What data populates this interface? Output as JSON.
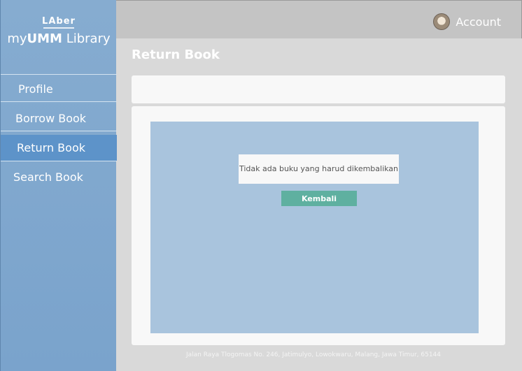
{
  "logo": {
    "mark": "LAber",
    "brand_prefix": "my",
    "brand_bold": "UMM",
    "brand_suffix": " Library"
  },
  "sidebar": {
    "items": [
      {
        "label": "Profile"
      },
      {
        "label": "Borrow Book"
      },
      {
        "label": "Return Book",
        "active": true
      },
      {
        "label": "Search Book"
      }
    ]
  },
  "header": {
    "account_label": "Account",
    "account_icon": "avatar"
  },
  "main": {
    "title": "Return Book",
    "message": "Tidak ada buku yang harud dikembalikan",
    "button_label": "Kembali"
  },
  "footer": {
    "address": "Jalan Raya Tlogomas No. 246, Jatimulyo, Lowokwaru, Malang, Jawa Timur, 65144"
  },
  "colors": {
    "sidebar": "#7aa3cc",
    "active_item": "#5d93c9",
    "header": "#c4c4c4",
    "panel": "#a9c4dd",
    "button": "#5fb0a0"
  }
}
